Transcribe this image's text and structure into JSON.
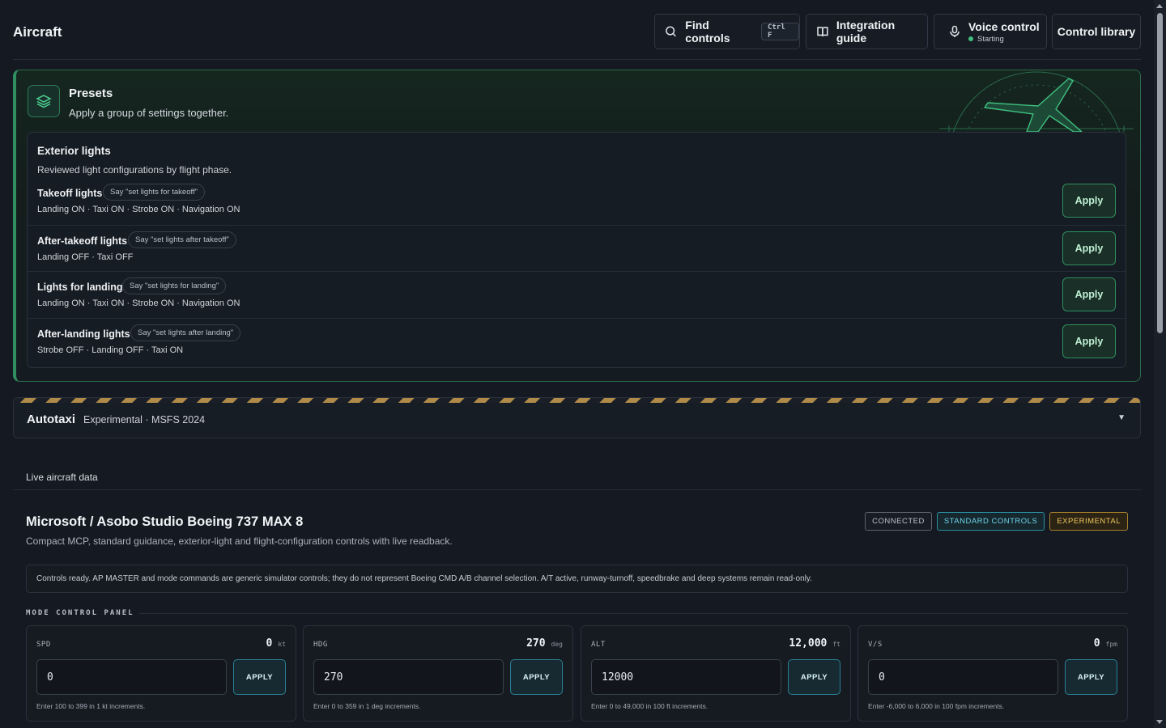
{
  "header": {
    "title": "Aircraft",
    "find": {
      "label": "Find controls",
      "shortcut": "Ctrl F",
      "icon": "search-icon"
    },
    "guide": {
      "label": "Integration guide",
      "icon": "book-icon"
    },
    "voice": {
      "label": "Voice control",
      "status": "Starting",
      "status_color": "#3fbf7f",
      "icon": "microphone-icon"
    },
    "library": {
      "label": "Control library"
    }
  },
  "presets": {
    "title": "Presets",
    "subtitle": "Apply a group of settings together.",
    "icon": "layers-icon",
    "accent": "#2f8f5f",
    "group": {
      "title": "Exterior lights",
      "subtitle": "Reviewed light configurations by flight phase.",
      "items": [
        {
          "name": "Takeoff lights",
          "say": "Say \"set lights for takeoff\"",
          "desc": "Landing ON · Taxi ON · Strobe ON · Navigation ON",
          "action": "Apply"
        },
        {
          "name": "After-takeoff lights",
          "say": "Say \"set lights after takeoff\"",
          "desc": "Landing OFF · Taxi OFF",
          "action": "Apply"
        },
        {
          "name": "Lights for landing",
          "say": "Say \"set lights for landing\"",
          "desc": "Landing ON · Taxi ON · Strobe ON · Navigation ON",
          "action": "Apply"
        },
        {
          "name": "After-landing lights",
          "say": "Say \"set lights after landing\"",
          "desc": "Strobe OFF · Landing OFF · Taxi ON",
          "action": "Apply"
        }
      ]
    }
  },
  "autotaxi": {
    "title": "Autotaxi",
    "meta": "Experimental · MSFS 2024",
    "collapsed": true
  },
  "live": {
    "tab": "Live aircraft data",
    "aircraft": {
      "title": "Microsoft / Asobo Studio Boeing 737 MAX 8",
      "subtitle": "Compact MCP, standard guidance, exterior-light and flight-configuration controls with live readback.",
      "badges": [
        "CONNECTED",
        "STANDARD CONTROLS",
        "EXPERIMENTAL"
      ]
    },
    "notice": "Controls ready. AP MASTER and mode commands are generic simulator controls; they do not represent Boeing CMD A/B channel selection. A/T active, runway-turnoff, speedbrake and deep systems remain read-only.",
    "mcp": {
      "label": "MODE CONTROL PANEL",
      "cards": [
        {
          "label": "SPD",
          "value": "0",
          "unit": "kt",
          "input": "0",
          "action": "APPLY",
          "help": "Enter 100 to 399 in 1 kt increments."
        },
        {
          "label": "HDG",
          "value": "270",
          "unit": "deg",
          "input": "270",
          "action": "APPLY",
          "help": "Enter 0 to 359 in 1 deg increments."
        },
        {
          "label": "ALT",
          "value": "12,000",
          "unit": "ft",
          "input": "12000",
          "action": "APPLY",
          "help": "Enter 0 to 49,000 in 100 ft increments."
        },
        {
          "label": "V/S",
          "value": "0",
          "unit": "fpm",
          "input": "0",
          "action": "APPLY",
          "help": "Enter -6,000 to 6,000 in 100 fpm increments."
        }
      ]
    }
  }
}
